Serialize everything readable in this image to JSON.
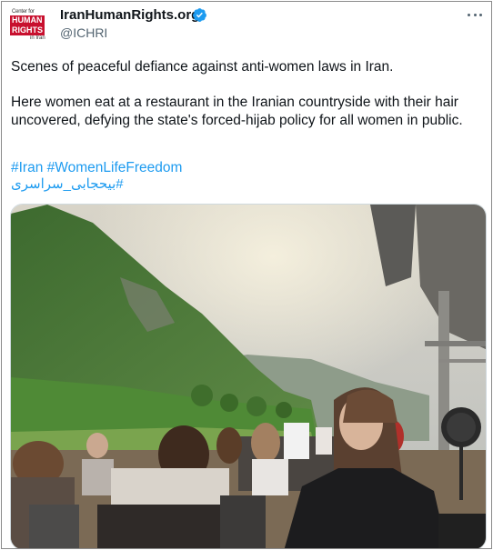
{
  "author": {
    "display_name": "IranHumanRights.org",
    "handle": "@ICHRI",
    "avatar": {
      "line1": "Center for",
      "line2": "HUMAN",
      "line3": "RIGHTS",
      "line4": "in Iran"
    },
    "verified": true
  },
  "tweet": {
    "paragraph1": "Scenes of peaceful defiance against anti-women laws in Iran.",
    "paragraph2": "Here women eat at a restaurant in the Iranian countryside with their hair uncovered, defying the state's forced-hijab policy for all women in public.",
    "hashtags": [
      "#Iran",
      "#WomenLifeFreedom"
    ],
    "hashtag_fa": "#بیحجابی_سراسری"
  },
  "colors": {
    "link": "#1d9bf0",
    "verified": "#1d9bf0",
    "brand": "#c8102e"
  },
  "icons": {
    "verified": "verified-badge-icon",
    "more": "more-options-icon"
  }
}
